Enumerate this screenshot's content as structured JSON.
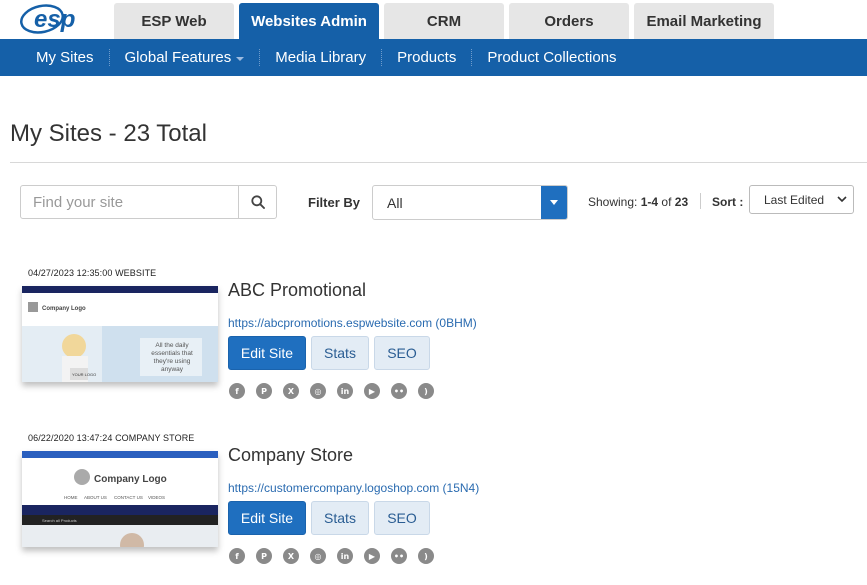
{
  "brand": {
    "logo_text": "esp",
    "primary_color": "#1560a8",
    "accent_color": "#1f6fbf"
  },
  "main_tabs": [
    {
      "label": "ESP Web",
      "active": false
    },
    {
      "label": "Websites Admin",
      "active": true
    },
    {
      "label": "CRM",
      "active": false
    },
    {
      "label": "Orders",
      "active": false
    },
    {
      "label": "Email Marketing",
      "active": false
    }
  ],
  "subnav": [
    {
      "label": "My Sites"
    },
    {
      "label": "Global Features",
      "has_dropdown": true
    },
    {
      "label": "Media Library"
    },
    {
      "label": "Products"
    },
    {
      "label": "Product Collections"
    }
  ],
  "page_title": "My Sites - 23 Total",
  "search": {
    "placeholder": "Find your site",
    "value": ""
  },
  "filter": {
    "label": "Filter By",
    "value": "All"
  },
  "showing": {
    "prefix": "Showing:",
    "range": "1-4",
    "of": "of",
    "total": "23"
  },
  "sort": {
    "label": "Sort :",
    "value": "Last Edited"
  },
  "sites": [
    {
      "meta": "04/27/2023 12:35:00 WEBSITE",
      "name": "ABC Promotional",
      "url": "https://abcpromotions.espwebsite.com (0BHM)",
      "thumb": {
        "logo": "Company Logo",
        "tagline": "All the daily essentials that they're using anyway",
        "secondary_logo": "YOUR LOGO"
      },
      "buttons": {
        "edit": "Edit Site",
        "stats": "Stats",
        "seo": "SEO"
      }
    },
    {
      "meta": "06/22/2020 13:47:24 COMPANY STORE",
      "name": "Company Store",
      "url": "https://customercompany.logoshop.com (15N4)",
      "thumb": {
        "logo": "Company Logo",
        "nav": [
          "HOME",
          "ABOUT US",
          "CONTACT US",
          "VIDEOS"
        ],
        "search": "Search all Products"
      },
      "buttons": {
        "edit": "Edit Site",
        "stats": "Stats",
        "seo": "SEO"
      }
    }
  ],
  "social_icons": [
    {
      "icon": "facebook-icon",
      "glyph": "f"
    },
    {
      "icon": "pinterest-icon",
      "glyph": "P"
    },
    {
      "icon": "x-icon",
      "glyph": "X"
    },
    {
      "icon": "instagram-icon",
      "glyph": "◎"
    },
    {
      "icon": "linkedin-icon",
      "glyph": "in"
    },
    {
      "icon": "youtube-icon",
      "glyph": "▶"
    },
    {
      "icon": "flickr-icon",
      "glyph": "••"
    },
    {
      "icon": "rss-icon",
      "glyph": ")"
    }
  ]
}
